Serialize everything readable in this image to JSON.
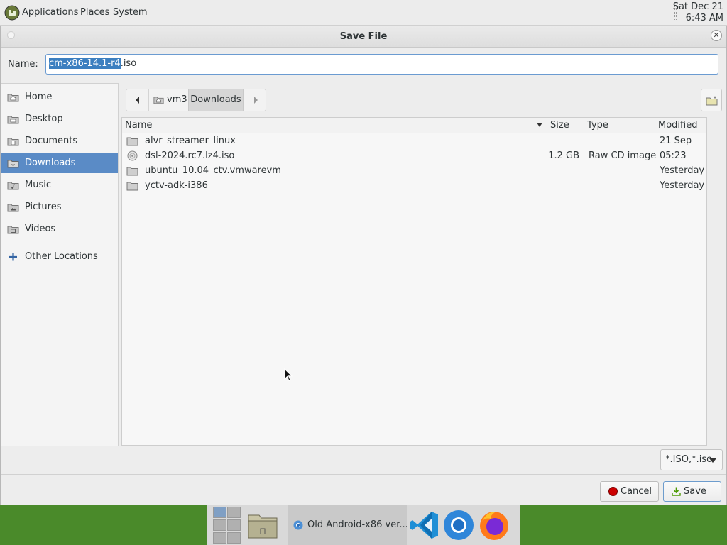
{
  "top_panel": {
    "menus": [
      "Applications",
      "Places",
      "System"
    ],
    "clock_date": "Sat Dec 21",
    "clock_time": "6:43 AM"
  },
  "dialog": {
    "title": "Save File",
    "name_label": "Name:",
    "name_value_selected": "cm-x86-14.1-r4",
    "name_value_rest": ".iso"
  },
  "sidebar": {
    "items": [
      {
        "label": "Home",
        "icon": "home-folder-icon"
      },
      {
        "label": "Desktop",
        "icon": "desktop-folder-icon"
      },
      {
        "label": "Documents",
        "icon": "documents-folder-icon"
      },
      {
        "label": "Downloads",
        "icon": "downloads-folder-icon",
        "active": true
      },
      {
        "label": "Music",
        "icon": "music-folder-icon"
      },
      {
        "label": "Pictures",
        "icon": "pictures-folder-icon"
      },
      {
        "label": "Videos",
        "icon": "videos-folder-icon"
      },
      {
        "label": "Other Locations",
        "icon": "plus-icon"
      }
    ]
  },
  "pathbar": {
    "home_segment": "vm3",
    "current_segment": "Downloads"
  },
  "filelist": {
    "columns": [
      "Name",
      "Size",
      "Type",
      "Modified"
    ],
    "rows": [
      {
        "name": "alvr_streamer_linux",
        "size": "",
        "type": "",
        "modified": "21 Sep",
        "icon": "folder-icon"
      },
      {
        "name": "dsl-2024.rc7.lz4.iso",
        "size": "1.2 GB",
        "type": "Raw CD image",
        "modified": "05:23",
        "icon": "disc-image-icon"
      },
      {
        "name": "ubuntu_10.04_ctv.vmwarevm",
        "size": "",
        "type": "",
        "modified": "Yesterday",
        "icon": "folder-icon"
      },
      {
        "name": "yctv-adk-i386",
        "size": "",
        "type": "",
        "modified": "Yesterday",
        "icon": "folder-icon"
      }
    ]
  },
  "filter": {
    "selected": "*.ISO,*.iso"
  },
  "actions": {
    "cancel": "Cancel",
    "save": "Save"
  },
  "taskbar": {
    "task_title": "Old Android-x86 ver..."
  },
  "colors": {
    "accent": "#5a8bc6",
    "selection": "#3c7fc0",
    "cancel_icon": "#cc0000",
    "save_icon": "#4e9a06"
  }
}
